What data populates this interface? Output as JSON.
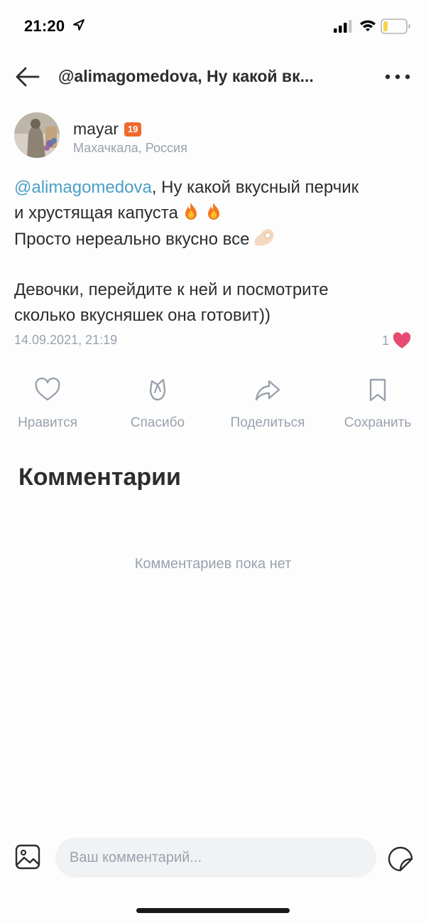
{
  "status_bar": {
    "time": "21:20",
    "icons": [
      "location-arrow-icon",
      "signal-icon",
      "wifi-icon",
      "battery-icon"
    ],
    "battery_level": 0.2,
    "battery_color": "#f5d54a"
  },
  "nav": {
    "title": "@alimagomedova, Ну какой вк...",
    "back_icon": "arrow-left-icon",
    "more_icon": "more-dots-icon"
  },
  "author": {
    "name": "mayar",
    "badge": "19",
    "location": "Махачкала, Россия",
    "badge_color": "#f06a2b"
  },
  "post": {
    "mention": "@alimagomedova",
    "line1_rest": ", Ну какой вкусный перчик",
    "line2": "и хрустящая капуста",
    "line2_emoji": "fire-emoji fire-emoji",
    "line3": "Просто нереально вкусно все",
    "line3_emoji": "ok-hand-emoji",
    "line4": "Девочки, перейдите к ней и посмотрите",
    "line5": "сколько вкусняшек она готовит))",
    "date": "14.09.2021, 21:19",
    "likes": "1",
    "mention_color": "#4a9fc4",
    "like_color": "#e64c72"
  },
  "actions": {
    "like_label": "Нравится",
    "thanks_label": "Спасибо",
    "share_label": "Поделиться",
    "save_label": "Сохранить"
  },
  "comments": {
    "title": "Комментарии",
    "empty_text": "Комментариев пока нет"
  },
  "composer": {
    "placeholder": "Ваш комментарий...",
    "attach_icon": "image-icon",
    "sticker_icon": "sticker-icon"
  }
}
